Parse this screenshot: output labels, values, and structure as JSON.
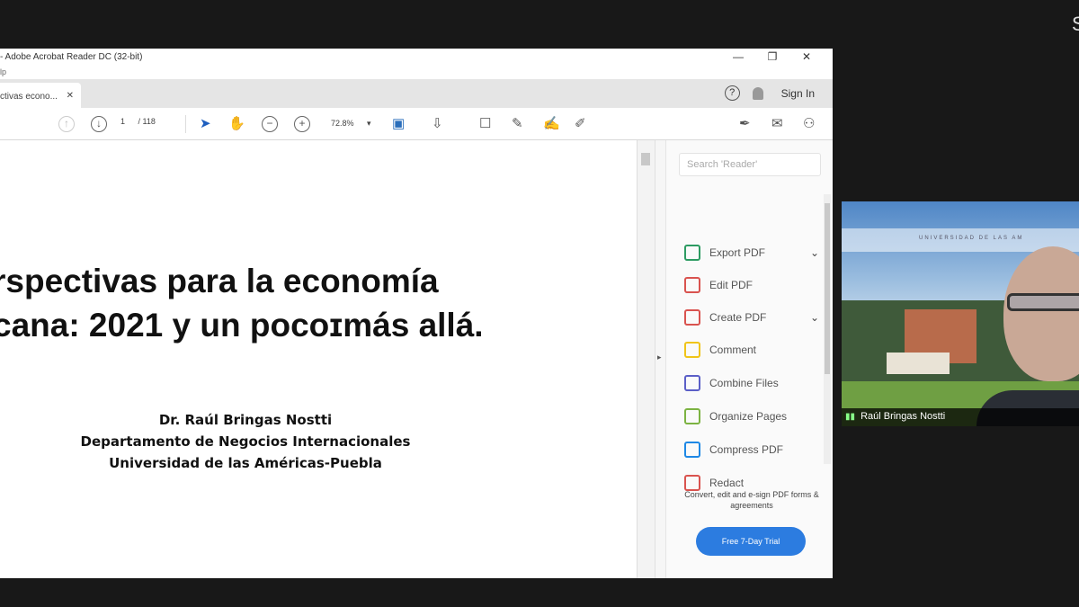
{
  "window": {
    "title": "- Adobe Acrobat Reader DC (32-bit)",
    "minimize": "—",
    "restore": "❐",
    "close": "✕"
  },
  "menubar": {
    "text": "lp"
  },
  "tab": {
    "label": "ctivas econo...",
    "close": "✕"
  },
  "topright": {
    "help": "?",
    "signin": "Sign In"
  },
  "toolbar": {
    "page_current": "1",
    "page_total": "/ 118",
    "zoom": "72.8%",
    "zoom_arrow": "▾"
  },
  "document": {
    "title_line1": "rspectivas para la economía",
    "title_line2": "cana: 2021 y un pocoɪmás allá.",
    "author": "Dr. Raúl Bringas Nostti",
    "department": "Departamento de Negocios Internacionales",
    "university": "Universidad de las Américas-Puebla"
  },
  "right_pane": {
    "search_placeholder": "Search 'Reader'",
    "tools": [
      {
        "label": "Export PDF",
        "icon": "export-pdf-icon",
        "color": "#2d9b62",
        "expand": true
      },
      {
        "label": "Edit PDF",
        "icon": "edit-pdf-icon",
        "color": "#d9534f",
        "expand": false
      },
      {
        "label": "Create PDF",
        "icon": "create-pdf-icon",
        "color": "#d9534f",
        "expand": true
      },
      {
        "label": "Comment",
        "icon": "comment-icon",
        "color": "#f0c419",
        "expand": false
      },
      {
        "label": "Combine Files",
        "icon": "combine-files-icon",
        "color": "#5b5fc7",
        "expand": false
      },
      {
        "label": "Organize Pages",
        "icon": "organize-pages-icon",
        "color": "#7cb342",
        "expand": false
      },
      {
        "label": "Compress PDF",
        "icon": "compress-pdf-icon",
        "color": "#1e88e5",
        "expand": false
      },
      {
        "label": "Redact",
        "icon": "redact-icon",
        "color": "#d9534f",
        "expand": false
      }
    ],
    "promo_text": "Convert, edit and e-sign PDF forms & agreements",
    "trial_button": "Free 7-Day Trial"
  },
  "video": {
    "banner_text": "UNIVERSIDAD DE LAS AM",
    "participant_name": "Raúl Bringas Nostti"
  },
  "corner_glyph": "S"
}
